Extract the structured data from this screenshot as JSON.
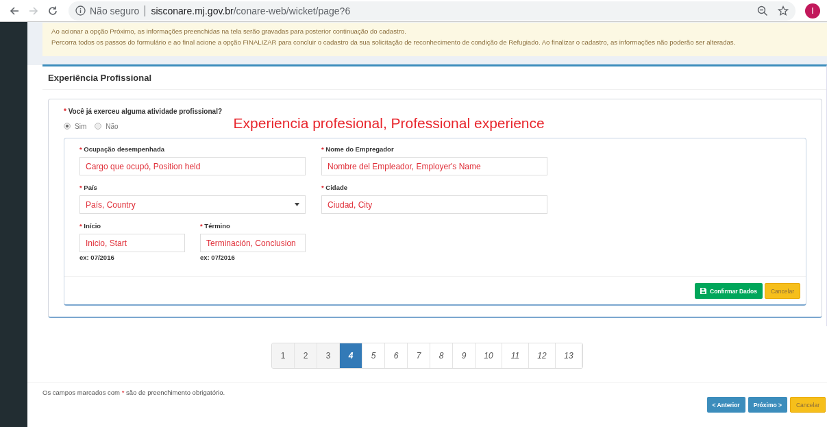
{
  "browser": {
    "security": "Não seguro",
    "host": "sisconare.mj.gov.br",
    "path": "/conare-web/wicket/page?6",
    "forward_disabled": true,
    "avatar": "I"
  },
  "notice": [
    "Ao acionar a opção Próximo, as informações preenchidas na tela serão gravadas para posterior continuação do cadastro.",
    "Percorra todos os passos do formulário e ao final acione a opção FINALIZAR para concluir o cadastro da sua solicitação de reconhecimento de condição de Refugiado. Ao finalizar o cadastro, as informações não poderão ser alteradas."
  ],
  "panel": {
    "title": "Experiência Profissional",
    "question": {
      "mark": "*",
      "label": "Você já exerceu alguma atividade profissional?",
      "options": [
        {
          "label": "Sim",
          "selected": true
        },
        {
          "label": "Não",
          "selected": false
        }
      ]
    },
    "annotation": "Experiencia profesional, Professional experience",
    "rows": [
      [
        {
          "kind": "text",
          "mark": "*",
          "label": "Ocupação desempenhada",
          "value": "Cargo que ocupó, Position held"
        },
        {
          "kind": "text",
          "mark": "*",
          "label": "Nome do Empregador",
          "value": "Nombre del Empleador, Employer's Name"
        }
      ],
      [
        {
          "kind": "select",
          "mark": "*",
          "label": "País",
          "value": "País, Country"
        },
        {
          "kind": "text",
          "mark": "*",
          "label": "Cidade",
          "value": "Ciudad, City"
        }
      ],
      [
        {
          "kind": "date",
          "mark": "*",
          "label": "Início",
          "value": "Inicio, Start",
          "hint": "ex: 07/2016"
        },
        {
          "kind": "date",
          "mark": "*",
          "label": "Término",
          "value": "Terminación, Conclusion",
          "hint": "ex: 07/2016"
        }
      ]
    ],
    "buttons": [
      {
        "kind": "confirm",
        "label": "Confirmar Dados"
      },
      {
        "kind": "cancel",
        "label": "Cancelar"
      }
    ]
  },
  "pages": [
    {
      "label": "1",
      "selected": false,
      "completed": true
    },
    {
      "label": "2",
      "selected": false,
      "completed": true
    },
    {
      "label": "3",
      "selected": false,
      "completed": true
    },
    {
      "label": "4",
      "selected": true,
      "completed": false
    },
    {
      "label": "5",
      "selected": false,
      "completed": false
    },
    {
      "label": "6",
      "selected": false,
      "completed": false
    },
    {
      "label": "7",
      "selected": false,
      "completed": false
    },
    {
      "label": "8",
      "selected": false,
      "completed": false
    },
    {
      "label": "9",
      "selected": false,
      "completed": false
    },
    {
      "label": "10",
      "selected": false,
      "completed": false
    },
    {
      "label": "11",
      "selected": false,
      "completed": false
    },
    {
      "label": "12",
      "selected": false,
      "completed": false
    },
    {
      "label": "13",
      "selected": false,
      "completed": false
    }
  ],
  "required_note": {
    "before": "Os campos marcados com",
    "mark": "*",
    "after": "são de preenchimento obrigatório."
  },
  "nav_buttons": [
    {
      "kind": "previous",
      "label": "< Anterior"
    },
    {
      "kind": "next",
      "label": "Próximo >"
    },
    {
      "kind": "cancel",
      "label": "Cancelar"
    }
  ]
}
